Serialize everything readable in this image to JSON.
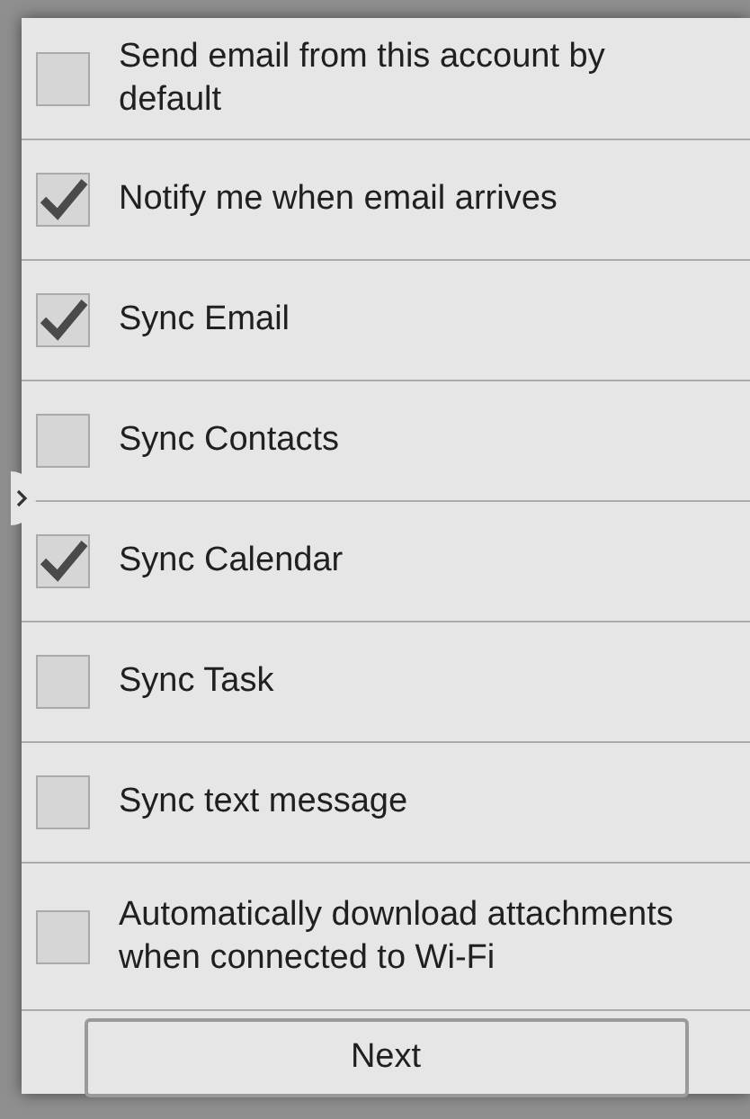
{
  "options": [
    {
      "label": "Send email from this account by default",
      "checked": false
    },
    {
      "label": "Notify me when email arrives",
      "checked": true
    },
    {
      "label": "Sync Email",
      "checked": true
    },
    {
      "label": "Sync Contacts",
      "checked": false
    },
    {
      "label": "Sync Calendar",
      "checked": true
    },
    {
      "label": "Sync Task",
      "checked": false
    },
    {
      "label": "Sync text message",
      "checked": false
    },
    {
      "label": "Automatically download attachments when connected to Wi-Fi",
      "checked": false
    }
  ],
  "next_button": "Next"
}
